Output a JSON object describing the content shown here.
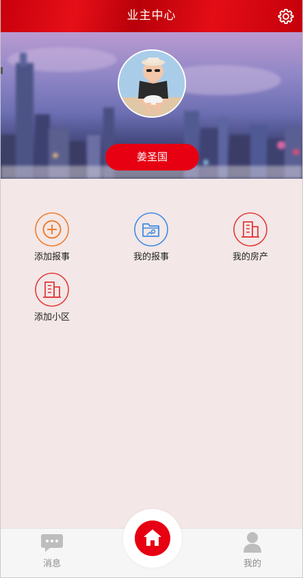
{
  "header": {
    "title": "业主中心",
    "settings_icon": "gear-icon"
  },
  "profile": {
    "name": "姜圣国",
    "avatar_icon": "user-avatar-photo"
  },
  "colors": {
    "brand_red": "#e60012",
    "orange": "#f07b2a",
    "blue": "#3a8be6",
    "content_bg": "#f3e7e7"
  },
  "menu": [
    {
      "label": "添加报事",
      "icon": "plus-circle-icon"
    },
    {
      "label": "我的报事",
      "icon": "folder-image-icon"
    },
    {
      "label": "我的房产",
      "icon": "building-icon"
    },
    {
      "label": "添加小区",
      "icon": "building-add-icon"
    }
  ],
  "tabbar": {
    "messages": {
      "label": "消息",
      "icon": "chat-bubble-icon"
    },
    "home": {
      "icon": "home-icon"
    },
    "mine": {
      "label": "我的",
      "icon": "person-icon"
    }
  }
}
